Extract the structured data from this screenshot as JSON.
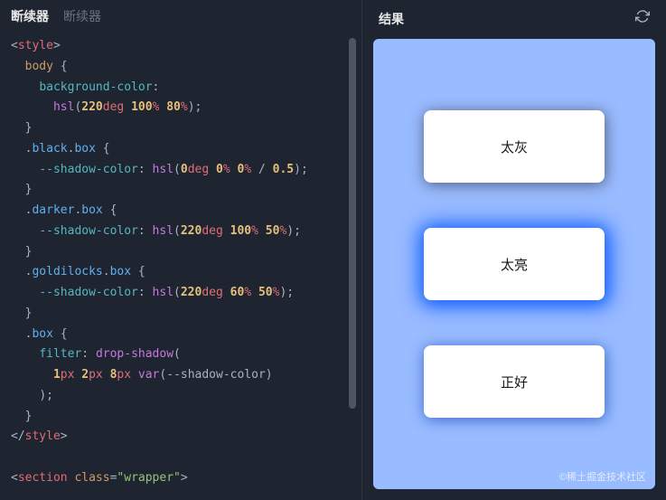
{
  "tabs": {
    "active": "断续器",
    "inactive": "断续器"
  },
  "code": {
    "l1": {
      "open": "<",
      "tag": "style",
      "close": ">"
    },
    "l2": {
      "sel": "body",
      "brace": " {"
    },
    "l3": {
      "prop": "background-color",
      "colon": ":"
    },
    "l4": {
      "func": "hsl",
      "lp": "(",
      "n1": "220",
      "u1": "deg",
      "n2": "100",
      "u2": "%",
      "n3": "80",
      "u3": "%",
      "rp": ")",
      "semi": ";"
    },
    "l5": {
      "brace": "}"
    },
    "l6": {
      "d1": ".",
      "c1": "black",
      "d2": ".",
      "c2": "box",
      "brace": " {"
    },
    "l7": {
      "prop": "--shadow-color",
      "colon": ": ",
      "func": "hsl",
      "lp": "(",
      "n1": "0",
      "u1": "deg",
      "n2": "0",
      "u2": "%",
      "n3": "0",
      "u3": "%",
      "slash": " / ",
      "n4": "0.5",
      "rp": ")",
      "semi": ";"
    },
    "l8": {
      "brace": "}"
    },
    "l9": {
      "d1": ".",
      "c1": "darker",
      "d2": ".",
      "c2": "box",
      "brace": " {"
    },
    "l10": {
      "prop": "--shadow-color",
      "colon": ": ",
      "func": "hsl",
      "lp": "(",
      "n1": "220",
      "u1": "deg",
      "n2": "100",
      "u2": "%",
      "n3": "50",
      "u3": "%",
      "rp": ")",
      "semi": ";"
    },
    "l11": {
      "brace": "}"
    },
    "l12": {
      "d1": ".",
      "c1": "goldilocks",
      "d2": ".",
      "c2": "box",
      "brace": " {"
    },
    "l13": {
      "prop": "--shadow-color",
      "colon": ": ",
      "func": "hsl",
      "lp": "(",
      "n1": "220",
      "u1": "deg",
      "n2": "60",
      "u2": "%",
      "n3": "50",
      "u3": "%",
      "rp": ")",
      "semi": ";"
    },
    "l14": {
      "brace": "}"
    },
    "l15": {
      "d1": ".",
      "c1": "box",
      "brace": " {"
    },
    "l16": {
      "prop": "filter",
      "colon": ": ",
      "func": "drop-shadow",
      "lp": "("
    },
    "l17": {
      "n1": "1",
      "u1": "px",
      "n2": "2",
      "u2": "px",
      "n3": "8",
      "u3": "px",
      "var": "var",
      "lp": "(",
      "vname": "--shadow-color",
      "rp": ")"
    },
    "l18": {
      "rp": ")",
      "semi": ";"
    },
    "l19": {
      "brace": "}"
    },
    "l20": {
      "open": "</",
      "tag": "style",
      "close": ">"
    },
    "l21": {
      "open": "<",
      "tag": "section",
      "attr": "class",
      "eq": "=",
      "val": "\"wrapper\"",
      "close": ">"
    }
  },
  "result": {
    "title": "结果",
    "boxes": [
      "太灰",
      "太亮",
      "正好"
    ]
  },
  "watermark": "©稀土掘金技术社区"
}
